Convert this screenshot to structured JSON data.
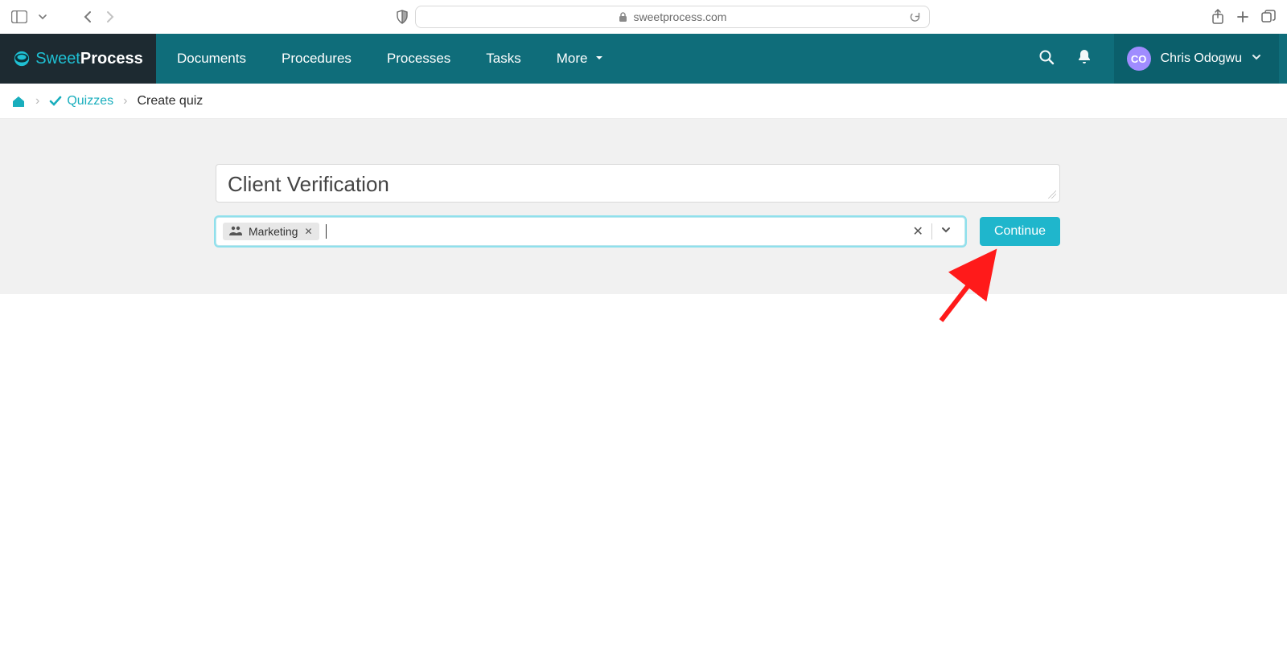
{
  "browser": {
    "url": "sweetprocess.com"
  },
  "app": {
    "logo": {
      "part1": "Sweet",
      "part2": "Process"
    },
    "nav": {
      "documents": "Documents",
      "procedures": "Procedures",
      "processes": "Processes",
      "tasks": "Tasks",
      "more": "More"
    },
    "user": {
      "initials": "CO",
      "name": "Chris Odogwu"
    }
  },
  "breadcrumb": {
    "quizzes_label": "Quizzes",
    "current": "Create quiz"
  },
  "form": {
    "title_value": "Client Verification",
    "tag": {
      "label": "Marketing"
    },
    "continue_label": "Continue"
  }
}
